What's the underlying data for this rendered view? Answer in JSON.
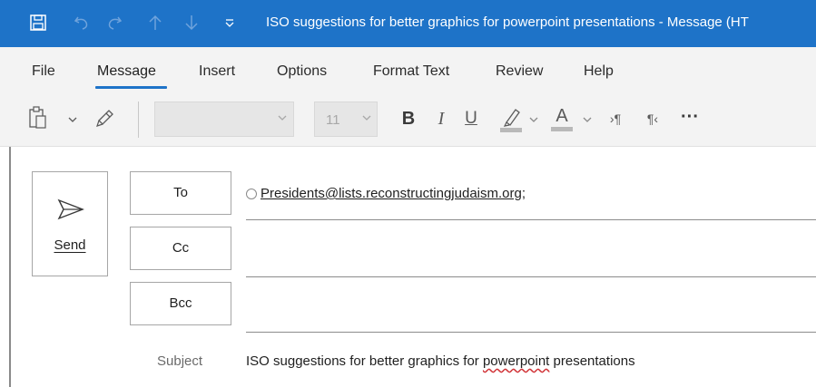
{
  "titlebar": {
    "title": "ISO suggestions for better graphics for powerpoint presentations  -  Message (HT",
    "icons": [
      "save-icon",
      "undo-icon",
      "redo-icon",
      "arrow-up-icon",
      "arrow-down-icon",
      "customize-qat-icon"
    ],
    "background": "#1e73c8"
  },
  "menu": {
    "items": [
      "File",
      "Message",
      "Insert",
      "Options",
      "Format Text",
      "Review",
      "Help"
    ],
    "active": "Message",
    "accent": "#1e73c8"
  },
  "ribbon": {
    "font_size": "11",
    "bold": "B",
    "italic": "I",
    "underline": "U",
    "font_color_letter": "A",
    "ltr": "›¶",
    "rtl": "¶‹",
    "more": "···"
  },
  "compose": {
    "send_label": "Send",
    "to_label": "To",
    "cc_label": "Cc",
    "bcc_label": "Bcc",
    "to_value": "Presidents@lists.reconstructingjudaism.org",
    "to_separator": ";",
    "subject_label": "Subject",
    "subject_parts": [
      "ISO suggestions for better graphics for ",
      "powerpoint",
      " presentations"
    ]
  }
}
